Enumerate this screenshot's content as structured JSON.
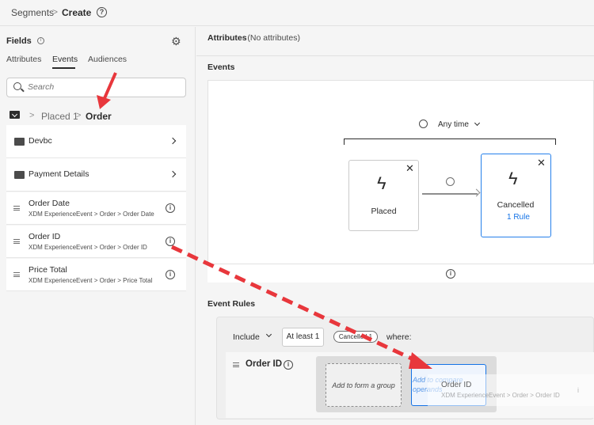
{
  "header": {
    "breadcrumb_parent": "Segments",
    "separator": ">",
    "breadcrumb_current": "Create",
    "help_icon": "?"
  },
  "fields_panel": {
    "title": "Fields",
    "info_icon": "i",
    "gear_icon": "⚙",
    "tabs": [
      "Attributes",
      "Events",
      "Audiences"
    ],
    "active_tab": "Events",
    "search_placeholder": "Search",
    "path": {
      "sep": ">",
      "parent": "Placed 1",
      "current": "Order"
    },
    "folders": [
      {
        "label": "Devbc"
      },
      {
        "label": "Payment Details"
      }
    ],
    "fields": [
      {
        "name": "Order Date",
        "path": "XDM ExperienceEvent > Order > Order Date"
      },
      {
        "name": "Order ID",
        "path": "XDM ExperienceEvent > Order > Order ID"
      },
      {
        "name": "Price Total",
        "path": "XDM ExperienceEvent > Order > Price Total"
      }
    ]
  },
  "attributes": {
    "title": "Attributes",
    "value": "- (No attributes)"
  },
  "events": {
    "title": "Events",
    "time_constraint": "Any time",
    "cards": [
      {
        "label": "Placed",
        "close": "✕"
      },
      {
        "label": "Cancelled",
        "rule": "1 Rule",
        "close": "✕"
      }
    ],
    "footer_info": "i"
  },
  "event_rules": {
    "title": "Event Rules",
    "include": "Include",
    "at_least": "At least 1",
    "event_chip": "Cancelled 1",
    "where": "where:",
    "rule_field": "Order ID",
    "group_placeholder": "Add to form a group",
    "compare_placeholder": "Add to compare operands",
    "drag_ghost": {
      "name": "Order ID",
      "path": "XDM ExperienceEvent > Order > Order ID",
      "info": "i"
    }
  },
  "colors": {
    "accent": "#1473e6",
    "annotation_arrow": "#e8373c"
  }
}
